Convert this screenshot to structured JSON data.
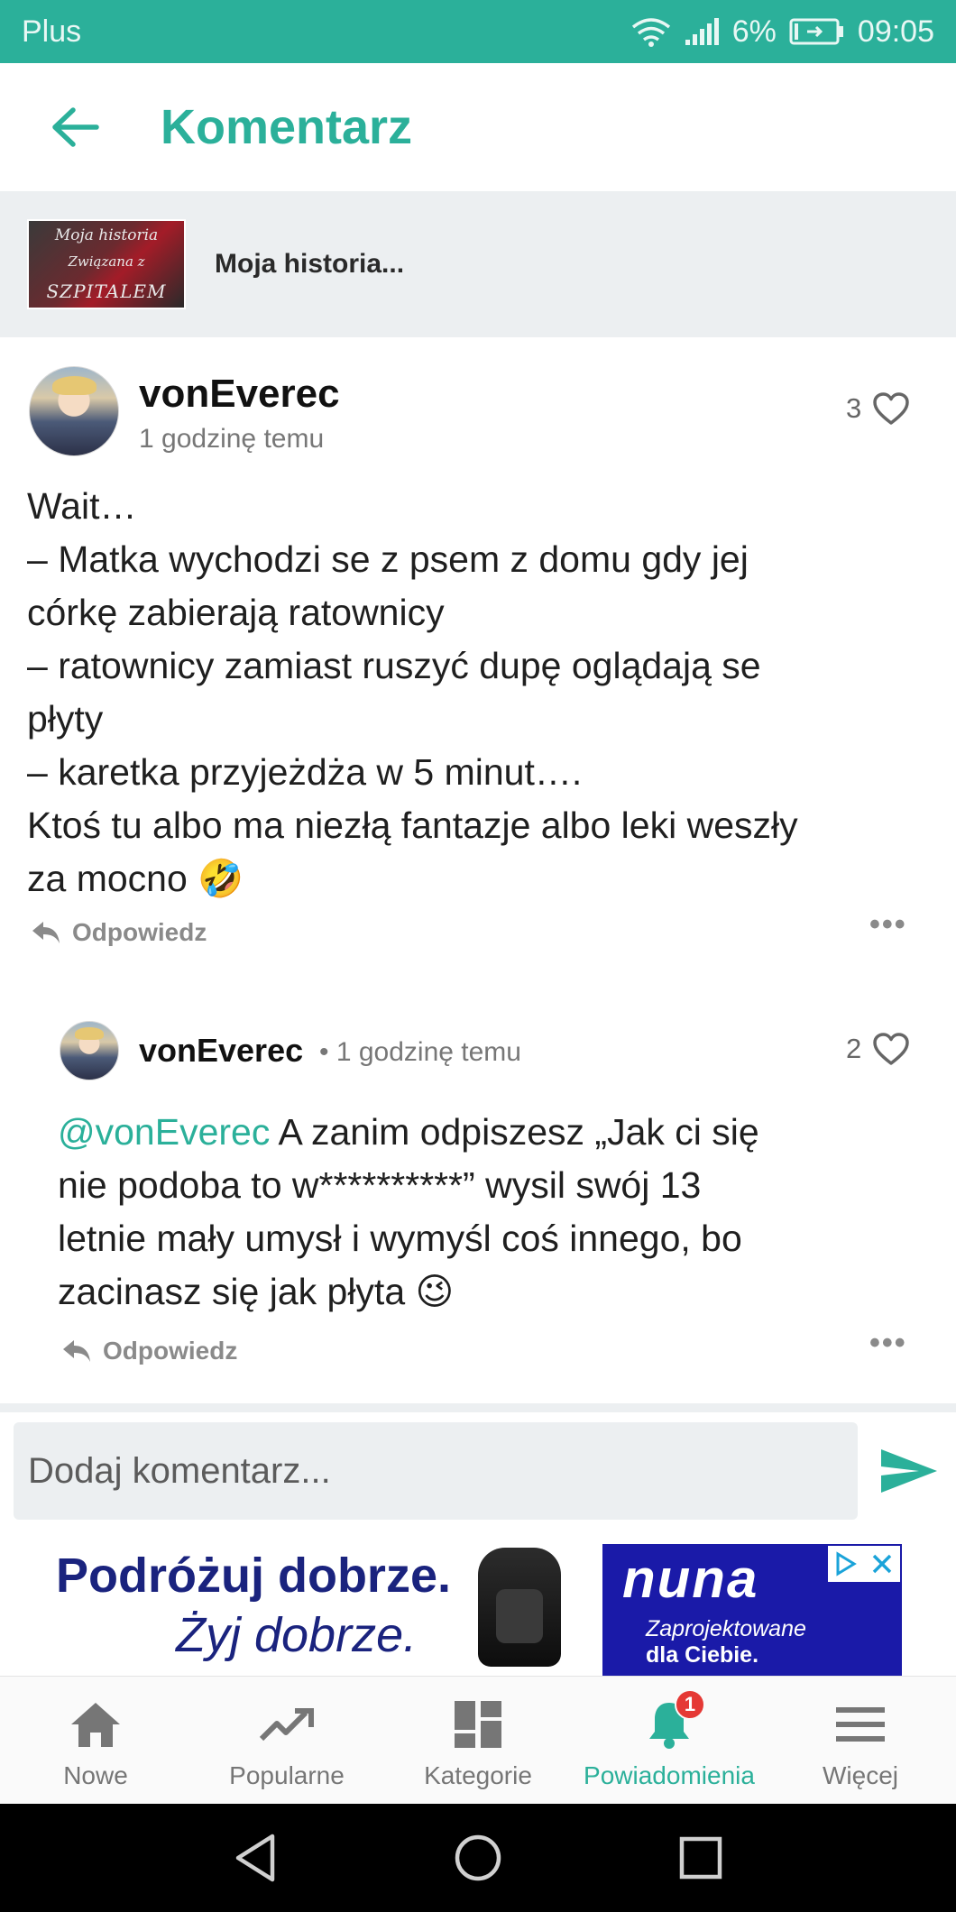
{
  "status_bar": {
    "carrier": "Plus",
    "battery": "6%",
    "time": "09:05"
  },
  "header": {
    "title": "Komentarz"
  },
  "story": {
    "thumbnail_lines": [
      "Moja historia",
      "Związana z",
      "SZPITALEM"
    ],
    "title": "Moja historia..."
  },
  "comments": [
    {
      "author": "vonEverec",
      "time": "1 godzinę temu",
      "likes": "3",
      "lines": [
        "Wait…",
        "– Matka wychodzi se z psem z domu gdy jej",
        "córkę zabierają ratownicy",
        "– ratownicy zamiast ruszyć dupę oglądają se",
        "płyty",
        "– karetka przyjeżdża w 5 minut….",
        "Ktoś tu albo ma niezłą fantazje albo leki weszły",
        "za mocno 🤣"
      ],
      "reply_label": "Odpowiedz"
    },
    {
      "author": "vonEverec",
      "time": "• 1 godzinę temu",
      "likes": "2",
      "mention": "@vonEverec",
      "lines": [
        " A zanim odpiszesz „Jak ci się",
        "nie podoba to w**********” wysil swój 13",
        "letnie mały umysł i wymyśl coś innego, bo",
        "zacinasz się jak płyta 😉"
      ],
      "reply_label": "Odpowiedz"
    }
  ],
  "composer": {
    "placeholder": "Dodaj komentarz..."
  },
  "ad": {
    "slogan_line1": "Podróżuj dobrze.",
    "slogan_line2": "Żyj dobrze.",
    "brand": "nuna",
    "tagline_line1": "Zaprojektowane",
    "tagline_line2": "dla Ciebie."
  },
  "bottom_nav": {
    "items": [
      {
        "label": "Nowe",
        "icon": "home-icon"
      },
      {
        "label": "Popularne",
        "icon": "trending-icon"
      },
      {
        "label": "Kategorie",
        "icon": "grid-icon"
      },
      {
        "label": "Powiadomienia",
        "icon": "bell-icon",
        "badge": "1",
        "active": true
      },
      {
        "label": "Więcej",
        "icon": "menu-icon"
      }
    ]
  },
  "colors": {
    "accent": "#2bb09a",
    "badge": "#e53935",
    "ad_blue": "#1a1aa8",
    "surface": "#eceff1"
  }
}
